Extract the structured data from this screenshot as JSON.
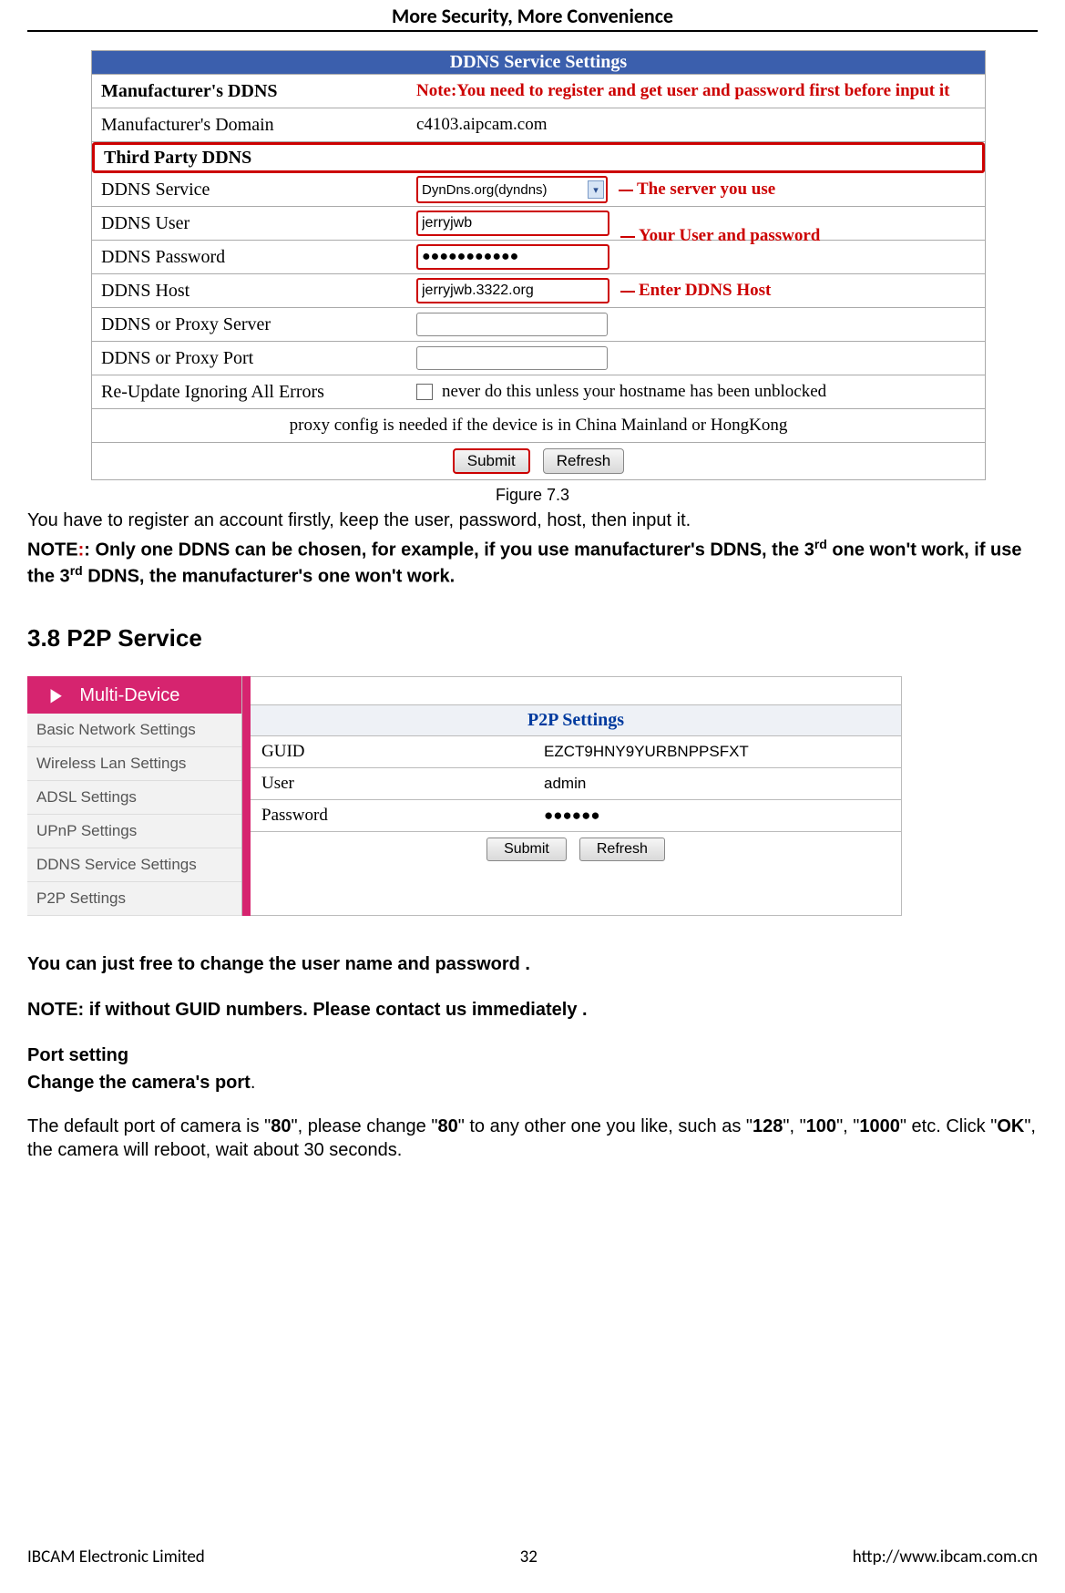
{
  "header": "More Security, More Convenience",
  "ddns": {
    "title": "DDNS Service Settings",
    "manufacturer_label": "Manufacturer's DDNS",
    "note_register": "Note:You need to register and get user and password first before input it",
    "manufacturer_domain_label": "Manufacturer's Domain",
    "manufacturer_domain_value": "c4103.aipcam.com",
    "third_party_label": "Third Party DDNS",
    "rows": {
      "service_label": "DDNS Service",
      "service_value": "DynDns.org(dyndns)",
      "service_annot": "The server you use",
      "user_label": "DDNS User",
      "user_value": "jerryjwb",
      "user_annot": "Your User and password",
      "password_label": "DDNS Password",
      "password_value": "●●●●●●●●●●●",
      "host_label": "DDNS Host",
      "host_value": "jerryjwb.3322.org",
      "host_annot": "Enter DDNS Host",
      "proxy_server_label": "DDNS or Proxy Server",
      "proxy_port_label": "DDNS or Proxy Port",
      "reupdate_label": "Re-Update Ignoring All Errors",
      "reupdate_text": "never do this unless your hostname has been unblocked",
      "proxy_note": "proxy config is needed if the device is in China Mainland or HongKong"
    },
    "submit": "Submit",
    "refresh": "Refresh"
  },
  "caption73": "Figure 7.3",
  "para_register": "You have to register an account firstly, keep the user, password, host, then input it.",
  "note_prefix": "NOTE",
  "note_oneddns_a": ": Only one DDNS can be chosen, for example, if you use manufacturer's DDNS, the 3",
  "note_oneddns_b": " one won't work, if use the 3",
  "note_oneddns_c": " DDNS, the manufacturer's one won't work.",
  "sup_rd": "rd",
  "section38": "3.8 P2P Service",
  "p2p": {
    "multidevice": "Multi-Device",
    "sidebar": [
      "Basic Network Settings",
      "Wireless Lan Settings",
      "ADSL Settings",
      "UPnP Settings",
      "DDNS Service Settings",
      "P2P Settings"
    ],
    "title": "P2P Settings",
    "guid_label": "GUID",
    "guid_value": "EZCT9HNY9YURBNPPSFXT",
    "user_label": "User",
    "user_value": "admin",
    "password_label": "Password",
    "password_value": "●●●●●●",
    "submit": "Submit",
    "refresh": "Refresh"
  },
  "para_change": "You can just   free to change the user name and password .",
  "para_noguid": "NOTE: if without GUID numbers.     Please contact us immediately .",
  "port_heading": "Port setting",
  "port_change": "Change the camera's port",
  "port_body_a": "The default port of camera is \"",
  "port_body_b": "\", please change \"",
  "port_body_c": "\" to any other one you like, such as \"",
  "port_body_d": "\", \"",
  "port_body_e": "\", \"",
  "port_body_f": "\" etc. Click \"",
  "port_body_g": "\", the camera will reboot, wait about 30 seconds.",
  "p80": "80",
  "p128": "128",
  "p100": "100",
  "p1000": "1000",
  "ok": "OK",
  "footer": {
    "left": "IBCAM Electronic Limited",
    "center": "32",
    "right": "http://www.ibcam.com.cn"
  }
}
